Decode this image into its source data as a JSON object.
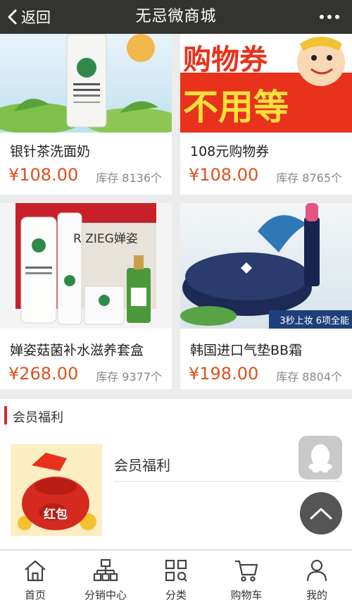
{
  "header": {
    "back_label": "返回",
    "title": "无忌微商城"
  },
  "products": [
    {
      "name": "银针茶洗面奶",
      "price": "¥108.00",
      "stock": "库存 8136个",
      "image": "cleanser-product-image"
    },
    {
      "name": "108元购物券",
      "price": "¥108.00",
      "stock": "库存 8765个",
      "image": "coupon-banner-image",
      "image_text_line1": "购物券",
      "image_text_line2": "不用等"
    },
    {
      "name": "婵姿菇菌补水滋养套盒",
      "price": "¥268.00",
      "stock": "库存 9377个",
      "image": "skincare-set-image",
      "image_text": "R ZIEG婵姿"
    },
    {
      "name": "韩国进口气垫BB霜",
      "price": "¥198.00",
      "stock": "库存 8804个",
      "image": "cushion-bb-image",
      "image_text": "3秒上妆 6项全能"
    }
  ],
  "member_section": {
    "title": "会员福利",
    "item_title": "会员福利",
    "thumb_text": "红包"
  },
  "floating": {
    "qq_icon": "qq-icon",
    "top_icon": "chevron-up-icon"
  },
  "tabbar": [
    {
      "label": "首页",
      "icon": "home-icon"
    },
    {
      "label": "分销中心",
      "icon": "org-chart-icon"
    },
    {
      "label": "分类",
      "icon": "category-grid-icon"
    },
    {
      "label": "购物车",
      "icon": "cart-icon"
    },
    {
      "label": "我的",
      "icon": "user-icon"
    }
  ],
  "colors": {
    "topbar": "#333331",
    "price": "#e0501e",
    "accent_bar": "#d8262e"
  }
}
